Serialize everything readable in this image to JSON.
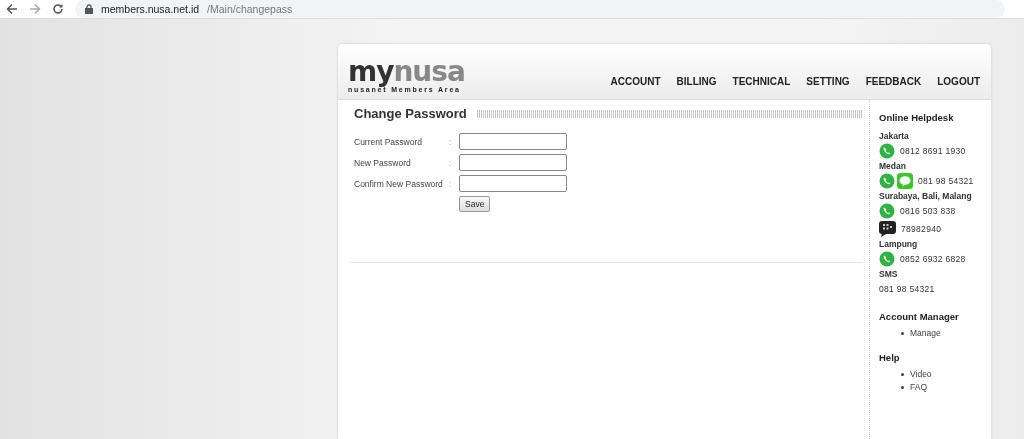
{
  "browser": {
    "url_host": "members.nusa.net.id",
    "url_path": "/Main/changepass"
  },
  "logo": {
    "prefix": "my",
    "suffix": "nusa",
    "tagline": "nusanet Members Area"
  },
  "nav": [
    {
      "label": "ACCOUNT"
    },
    {
      "label": "BILLING"
    },
    {
      "label": "TECHNICAL"
    },
    {
      "label": "SETTING"
    },
    {
      "label": "FEEDBACK"
    },
    {
      "label": "LOGOUT"
    }
  ],
  "form": {
    "title": "Change Password",
    "fields": [
      {
        "label": "Current Password",
        "separator": ":"
      },
      {
        "label": "New Password",
        "separator": ":"
      },
      {
        "label": "Confirm New Password",
        "separator": ":"
      }
    ],
    "submit": "Save"
  },
  "sidebar": {
    "helpdesk": {
      "title": "Online Helpdesk",
      "groups": [
        {
          "city": "Jakarta",
          "contacts": [
            {
              "icons": [
                {
                  "kind": "whatsapp"
                }
              ],
              "number": "0812 8691 1930"
            }
          ]
        },
        {
          "city": "Medan",
          "contacts": [
            {
              "icons": [
                {
                  "kind": "whatsapp"
                },
                {
                  "kind": "line"
                }
              ],
              "number": "081 98 54321"
            }
          ]
        },
        {
          "city": "Surabaya, Bali, Malang",
          "contacts": [
            {
              "icons": [
                {
                  "kind": "whatsapp"
                }
              ],
              "number": "0816 503 838"
            },
            {
              "icons": [
                {
                  "kind": "bbm"
                }
              ],
              "number": "78982940"
            }
          ]
        },
        {
          "city": "Lampung",
          "contacts": [
            {
              "icons": [
                {
                  "kind": "whatsapp"
                }
              ],
              "number": "0852 6932 6828"
            }
          ]
        },
        {
          "city": "SMS",
          "contacts": [
            {
              "number": "081 98 54321"
            }
          ]
        }
      ]
    },
    "sections": [
      {
        "title": "Account Manager",
        "links": [
          "Manage"
        ]
      },
      {
        "title": "Help",
        "links": [
          "Video",
          "FAQ"
        ]
      }
    ]
  }
}
